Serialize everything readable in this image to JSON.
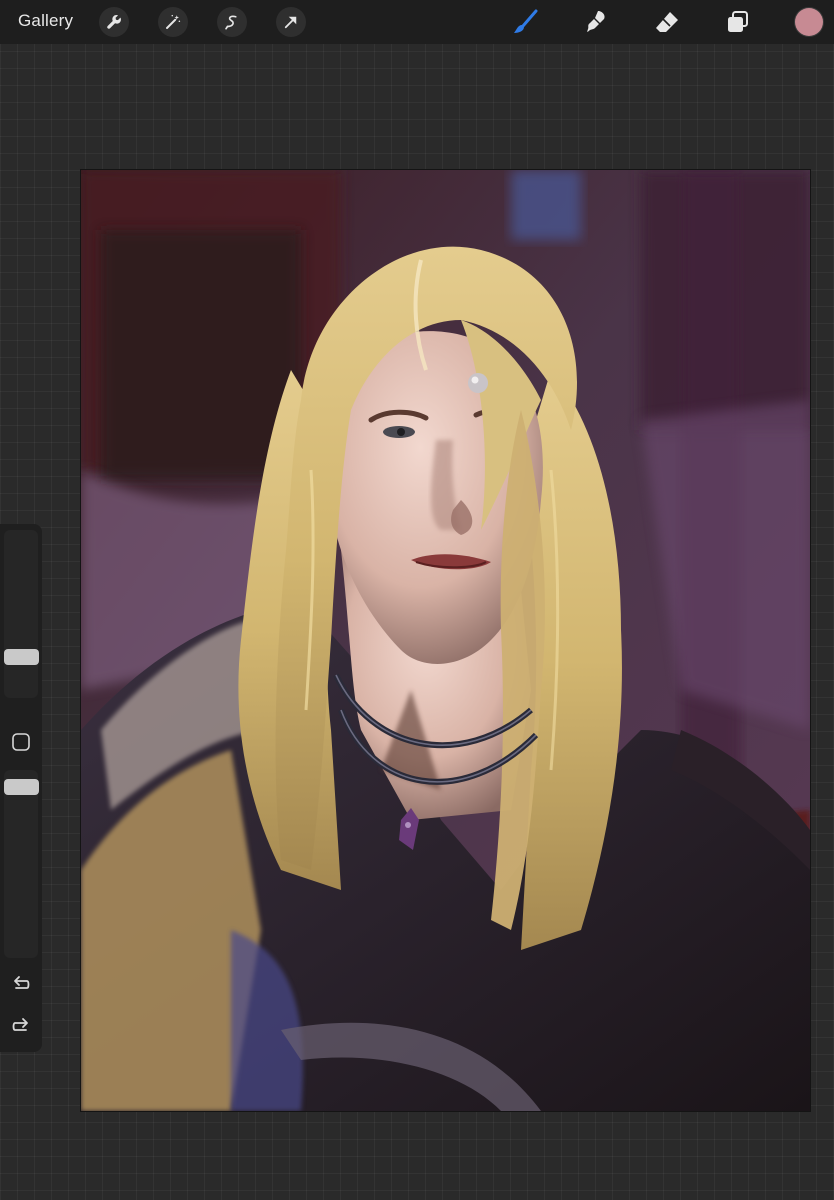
{
  "topbar": {
    "gallery_label": "Gallery",
    "left_tools": [
      "wrench-icon",
      "magic-wand-icon",
      "selection-icon",
      "transform-arrow-icon"
    ],
    "right_tools": {
      "brush": {
        "icon": "brush-icon",
        "active": true,
        "color": "#2f7be6"
      },
      "smudge": {
        "icon": "smudge-icon"
      },
      "eraser": {
        "icon": "eraser-icon"
      },
      "layers": {
        "icon": "layers-icon"
      },
      "current_color": "#c78a93"
    }
  },
  "sidebar": {
    "brush_size_level": 0.22,
    "opacity_level": 0.95,
    "modify_icon": "modify-square-icon",
    "undo_icon": "undo-icon",
    "redo_icon": "redo-icon"
  },
  "canvas": {
    "artwork": "painted-portrait"
  }
}
